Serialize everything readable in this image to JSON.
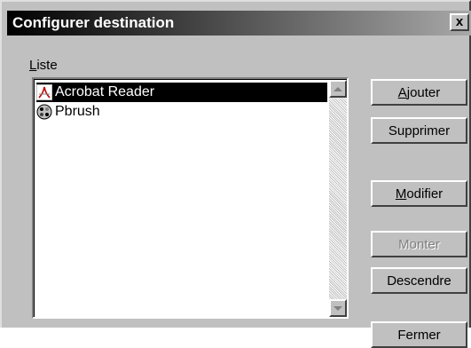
{
  "window": {
    "title": "Configurer destination",
    "close_label": "x"
  },
  "list": {
    "label": "Liste",
    "mnemonic": "L",
    "label_rest": "iste",
    "items": [
      {
        "label": "Acrobat Reader",
        "icon": "acrobat-icon",
        "selected": true
      },
      {
        "label": "Pbrush",
        "icon": "paintbrush-icon",
        "selected": false
      }
    ]
  },
  "buttons": {
    "add": {
      "mnemonic": "A",
      "rest": "jouter",
      "enabled": true
    },
    "delete": {
      "label": "Supprimer",
      "enabled": true
    },
    "modify": {
      "mnemonic": "M",
      "rest": "odifier",
      "enabled": true
    },
    "move_up": {
      "label": "Monter",
      "enabled": false
    },
    "move_down": {
      "label": "Descendre",
      "enabled": true
    },
    "close": {
      "label": "Fermer",
      "enabled": true
    }
  },
  "colors": {
    "selection_bg": "#000000",
    "dialog_bg": "#c0c0c0",
    "disabled_text": "#808080"
  }
}
